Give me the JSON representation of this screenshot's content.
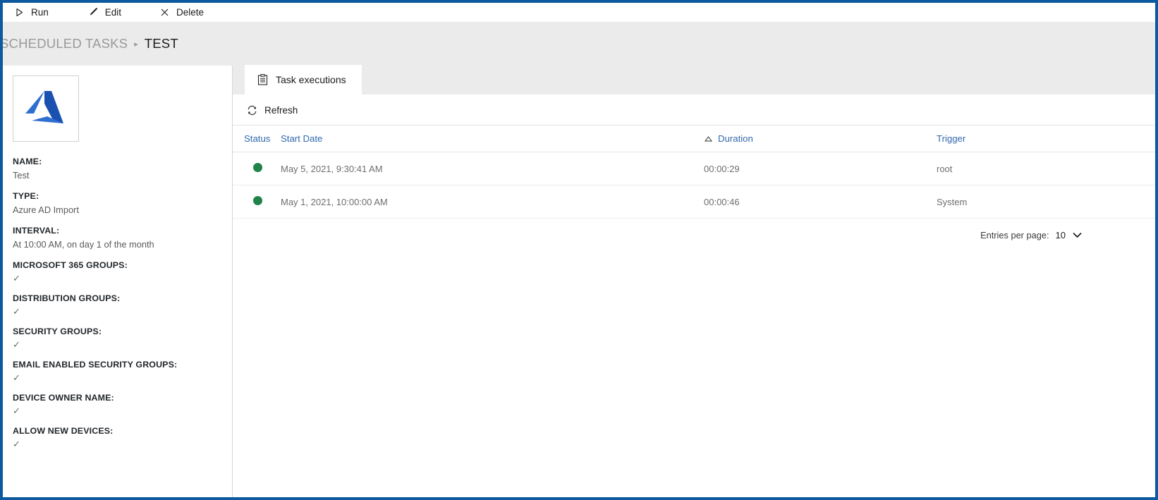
{
  "theme": {
    "window_border": "#0d5a9e",
    "band_bg": "#ebebeb",
    "link_blue": "#3169ad",
    "status_green": "#1e8449",
    "azure_blue": "#1f5fc4"
  },
  "command_bar": {
    "buttons": [
      {
        "label": "Run",
        "icon": "play-icon"
      },
      {
        "label": "Edit",
        "icon": "pencil-icon"
      },
      {
        "label": "Delete",
        "icon": "close-x-icon"
      }
    ]
  },
  "breadcrumb": {
    "parent": "SCHEDULED TASKS",
    "separator": "▸",
    "current": "TEST"
  },
  "detail": {
    "logo_icon": "azure-logo-icon",
    "properties": [
      {
        "label": "NAME:",
        "value": "Test"
      },
      {
        "label": "TYPE:",
        "value": "Azure AD Import"
      },
      {
        "label": "INTERVAL:",
        "value": "At 10:00 AM, on day 1 of the month"
      },
      {
        "label": "MICROSOFT 365 GROUPS:",
        "value": "✓"
      },
      {
        "label": "DISTRIBUTION GROUPS:",
        "value": "✓"
      },
      {
        "label": "SECURITY GROUPS:",
        "value": "✓"
      },
      {
        "label": "EMAIL ENABLED SECURITY GROUPS:",
        "value": "✓"
      },
      {
        "label": "DEVICE OWNER NAME:",
        "value": "✓"
      },
      {
        "label": "ALLOW NEW DEVICES:",
        "value": "✓"
      }
    ]
  },
  "content": {
    "tabs": [
      {
        "label": "Task executions",
        "icon": "clipboard-list-icon",
        "active": true
      }
    ],
    "toolbar": {
      "refresh_label": "Refresh",
      "refresh_icon": "refresh-icon"
    },
    "table": {
      "columns": [
        {
          "key": "status",
          "label": "Status",
          "sorted": false
        },
        {
          "key": "start_date",
          "label": "Start Date",
          "sorted": false
        },
        {
          "key": "duration",
          "label": "Duration",
          "sorted": true,
          "sort_dir": "asc",
          "sort_icon": "sort-ascending-icon"
        },
        {
          "key": "trigger",
          "label": "Trigger",
          "sorted": false
        }
      ],
      "rows": [
        {
          "status": "success",
          "status_icon": "status-dot-green",
          "start_date": "May 5, 2021, 9:30:41 AM",
          "duration": "00:00:29",
          "trigger": "root"
        },
        {
          "status": "success",
          "status_icon": "status-dot-green",
          "start_date": "May 1, 2021, 10:00:00 AM",
          "duration": "00:00:46",
          "trigger": "System"
        }
      ]
    },
    "pagination": {
      "label": "Entries per page:",
      "value": "10",
      "chevron_icon": "chevron-down-icon"
    }
  }
}
